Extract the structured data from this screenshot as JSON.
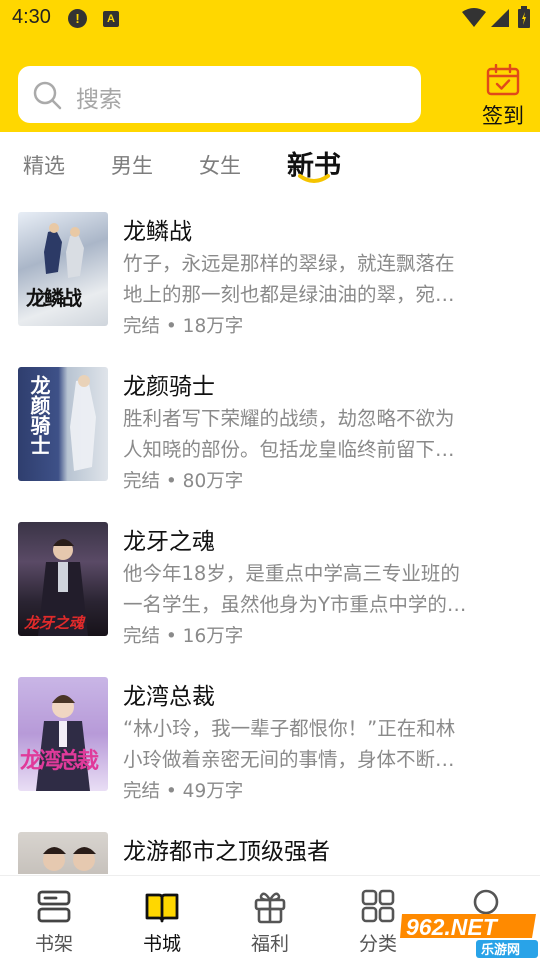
{
  "status_bar": {
    "time": "4:30",
    "icons": [
      "alert-icon",
      "a-icon",
      "wifi-icon",
      "signal-icon",
      "battery-icon"
    ],
    "alert_glyph": "!",
    "a_glyph": "A"
  },
  "search": {
    "placeholder": "搜索",
    "icon": "search-icon"
  },
  "checkin": {
    "label": "签到",
    "icon": "calendar-check-icon"
  },
  "tabs": [
    {
      "label": "精选",
      "active": false
    },
    {
      "label": "男生",
      "active": false
    },
    {
      "label": "女生",
      "active": false
    },
    {
      "label": "新书",
      "active": true
    }
  ],
  "books": [
    {
      "title": "龙鳞战",
      "desc_line1": "竹子，永远是那样的翠绿，就连飘落在",
      "desc_line2": "地上的那一刻也都是绿油油的翠，宛…",
      "meta": "完结 • 18万字",
      "cover_text": "龙鳞战"
    },
    {
      "title": "龙颜骑士",
      "desc_line1": "胜利者写下荣耀的战绩，劫忽略不欲为",
      "desc_line2": "人知晓的部份。包括龙皇临终前留下…",
      "meta": "完结 • 80万字",
      "cover_text": "龙颜骑士"
    },
    {
      "title": "龙牙之魂",
      "desc_line1": "他今年18岁，是重点中学高三专业班的",
      "desc_line2": "一名学生，虽然他身为Y市重点中学的…",
      "meta": "完结 • 16万字",
      "cover_text": "龙牙之魂"
    },
    {
      "title": "龙湾总裁",
      "desc_line1": "“林小玲，我一辈子都恨你！”正在和林",
      "desc_line2": "小玲做着亲密无间的事情，身体不断…",
      "meta": "完结 • 49万字",
      "cover_text": "龙湾总裁"
    },
    {
      "title": "龙游都市之顶级强者",
      "desc_line1": "",
      "desc_line2": "",
      "meta": "",
      "cover_text": ""
    }
  ],
  "bottom_nav": [
    {
      "label": "书架",
      "icon": "bookshelf-icon",
      "active": false
    },
    {
      "label": "书城",
      "icon": "bookstore-icon",
      "active": true
    },
    {
      "label": "福利",
      "icon": "gift-icon",
      "active": false
    },
    {
      "label": "分类",
      "icon": "category-icon",
      "active": false
    },
    {
      "label": "",
      "icon": "profile-icon",
      "active": false
    }
  ],
  "watermark": {
    "brand": "962.NET",
    "sub": "乐游网"
  },
  "colors": {
    "accent": "#FFD700",
    "text_primary": "#111111",
    "text_secondary": "#8a8a8a"
  }
}
